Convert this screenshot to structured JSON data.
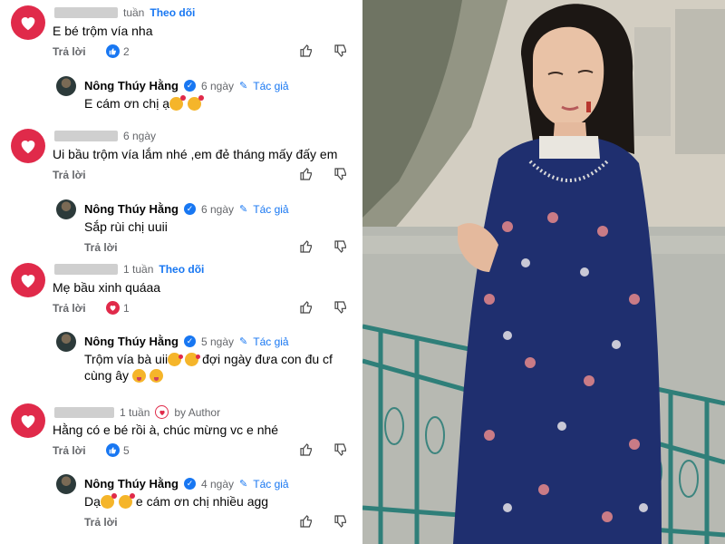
{
  "comments": [
    {
      "time": "tuần",
      "follow": "Theo dõi",
      "text": "E bé trộm vía nha",
      "reply": "Trả lời",
      "react_count": "2",
      "react_type": "like",
      "author_reply": {
        "name": "Nông Thúy Hằng",
        "time": "6 ngày",
        "badge": "Tác giả",
        "text": "E cám ơn chị ạ",
        "reply": ""
      }
    },
    {
      "time": "6 ngày",
      "follow": "",
      "text": "Ui bầu trộm vía lắm nhé ,em đẻ tháng mấy đấy em",
      "reply": "Trả lời",
      "react_count": "",
      "react_type": "",
      "author_reply": {
        "name": "Nông Thúy Hằng",
        "time": "6 ngày",
        "badge": "Tác giả",
        "text": "Sắp rùi chị uuii",
        "reply": "Trả lời"
      }
    },
    {
      "time": "1 tuần",
      "follow": "Theo dõi",
      "text": "Mẹ bầu xinh quáaa",
      "reply": "Trả lời",
      "react_count": "1",
      "react_type": "heart",
      "author_reply": {
        "name": "Nông Thúy Hằng",
        "time": "5 ngày",
        "badge": "Tác giả",
        "text": "Trộm vía bà uii",
        "text2": "đợi ngày đưa con đu cf",
        "text3": "cùng ây",
        "reply": ""
      }
    },
    {
      "time": "1 tuần",
      "follow": "",
      "by_author": "by Author",
      "text": "Hằng có e bé rồi à, chúc mừng vc e nhé",
      "reply": "Trả lời",
      "react_count": "5",
      "react_type": "like",
      "author_reply": {
        "name": "Nông Thúy Hằng",
        "time": "4 ngày",
        "badge": "Tác giả",
        "text": "Dạ",
        "text2": "e cám ơn chị nhiều agg",
        "reply": "Trả lời"
      }
    }
  ],
  "colors": {
    "accent": "#1877f2",
    "heart": "#e02a4a",
    "muted": "#65676b"
  }
}
